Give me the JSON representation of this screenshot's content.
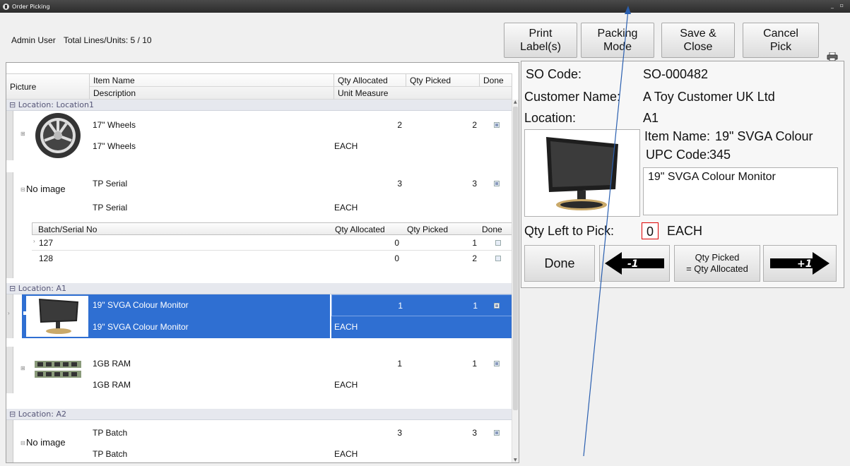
{
  "window": {
    "title": "Order Picking",
    "controls": "_ ▫"
  },
  "status": {
    "user": "Admin User",
    "totals": "Total Lines/Units: 5 / 10"
  },
  "toolbar": {
    "print_label": "Print\nLabel(s)",
    "packing_mode": "Packing\nMode",
    "save_close": "Save &\nClose",
    "cancel_pick": "Cancel\nPick"
  },
  "grid": {
    "headers": {
      "picture": "Picture",
      "item_name": "Item Name",
      "description": "Description",
      "qty_allocated": "Qty Allocated",
      "unit_measure": "Unit Measure",
      "qty_picked": "Qty Picked",
      "done": "Done"
    },
    "groups": [
      {
        "label": "Location: Location1"
      },
      {
        "label": "Location: A1"
      },
      {
        "label": "Location: A2"
      }
    ],
    "rows": [
      {
        "item": "17\" Wheels",
        "desc": "17\" Wheels",
        "qty_alloc": "2",
        "unit": "EACH",
        "qty_picked": "2",
        "done": true,
        "picture": "wheel"
      },
      {
        "item": "TP Serial",
        "desc": "TP Serial",
        "qty_alloc": "3",
        "unit": "EACH",
        "qty_picked": "3",
        "done": true,
        "picture": "No image"
      },
      {
        "item": "19\" SVGA Colour Monitor",
        "desc": "19\" SVGA Colour Monitor",
        "qty_alloc": "1",
        "unit": "EACH",
        "qty_picked": "1",
        "done": true,
        "picture": "monitor"
      },
      {
        "item": "1GB RAM",
        "desc": "1GB RAM",
        "qty_alloc": "1",
        "unit": "EACH",
        "qty_picked": "1",
        "done": true,
        "picture": "ram"
      },
      {
        "item": "TP Batch",
        "desc": "TP Batch",
        "qty_alloc": "3",
        "unit": "EACH",
        "qty_picked": "3",
        "done": true,
        "picture": "No image"
      }
    ],
    "subgrid": {
      "headers": {
        "batch": "Batch/Serial No",
        "qty_allocated": "Qty Allocated",
        "qty_picked": "Qty Picked",
        "done": "Done"
      },
      "rows": [
        {
          "batch": "127",
          "qty_alloc": "0",
          "qty_picked": "1",
          "done": false
        },
        {
          "batch": "128",
          "qty_alloc": "0",
          "qty_picked": "2",
          "done": false
        }
      ]
    }
  },
  "detail": {
    "so_code_label": "SO Code:",
    "so_code": "SO-000482",
    "customer_label": "Customer Name:",
    "customer": "A Toy Customer UK Ltd",
    "location_label": "Location:",
    "location": "A1",
    "item_name_label": "Item Name:",
    "item_name": "19\" SVGA Colour",
    "upc_label": "UPC Code:",
    "upc": "345",
    "description": "19\" SVGA Colour Monitor",
    "qty_left_label": "Qty Left to Pick:",
    "qty_left": "0",
    "qty_unit": "EACH",
    "done_button": "Done",
    "minus_label": "-1",
    "plus_label": "+1",
    "qty_equal_button": "Qty Picked\n= Qty Allocated"
  },
  "colors": {
    "selection": "#2f6fd2",
    "annotation_arrow": "#2a5fb0"
  }
}
